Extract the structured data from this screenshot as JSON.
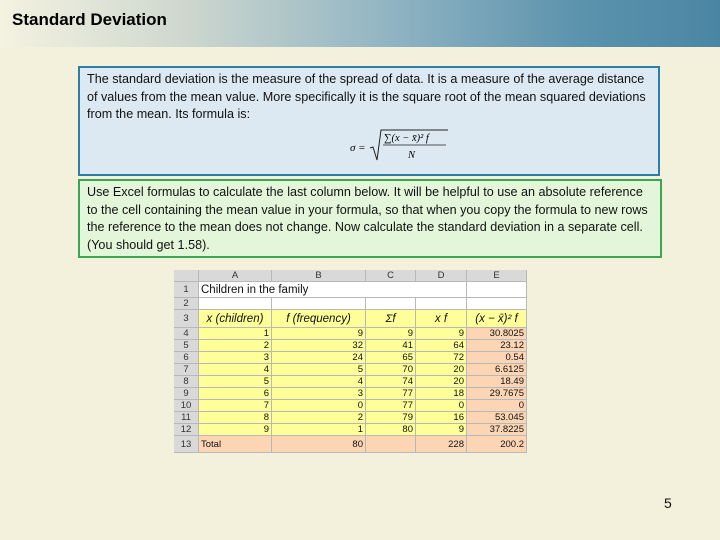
{
  "title": "Standard Deviation",
  "intro_text": "The standard deviation is the measure of the spread of data. It is a measure of the average distance of values from the mean value. More specifically it is the square root of the mean squared deviations from the mean. Its formula is:",
  "formula": {
    "lhs": "σ =",
    "numerator": "∑(x − x̄)² f",
    "denominator": "N"
  },
  "instruction_text": "Use Excel formulas to calculate the last column below. It will be helpful to use an absolute reference to the cell containing the mean value in your formula, so that when you copy the formula to new rows the reference to the mean does not change. Now calculate the standard deviation in a separate cell. (You should get 1.58).",
  "spreadsheet": {
    "column_letters": [
      "A",
      "B",
      "C",
      "D",
      "E"
    ],
    "sheet_title": "Children in the family",
    "headers": [
      "x (children)",
      "f (frequency)",
      "Σf",
      "x f",
      "(x − x̄)² f"
    ],
    "rows": [
      [
        "1",
        "9",
        "9",
        "9",
        "30.8025"
      ],
      [
        "2",
        "32",
        "41",
        "64",
        "23.12"
      ],
      [
        "3",
        "24",
        "65",
        "72",
        "0.54"
      ],
      [
        "4",
        "5",
        "70",
        "20",
        "6.6125"
      ],
      [
        "5",
        "4",
        "74",
        "20",
        "18.49"
      ],
      [
        "6",
        "3",
        "77",
        "18",
        "29.7675"
      ],
      [
        "7",
        "0",
        "77",
        "0",
        "0"
      ],
      [
        "8",
        "2",
        "79",
        "16",
        "53.045"
      ],
      [
        "9",
        "1",
        "80",
        "9",
        "37.8225"
      ]
    ],
    "total_label": "Total",
    "totals": [
      "",
      "80",
      "",
      "228",
      "200.2"
    ]
  },
  "page_number": "5"
}
